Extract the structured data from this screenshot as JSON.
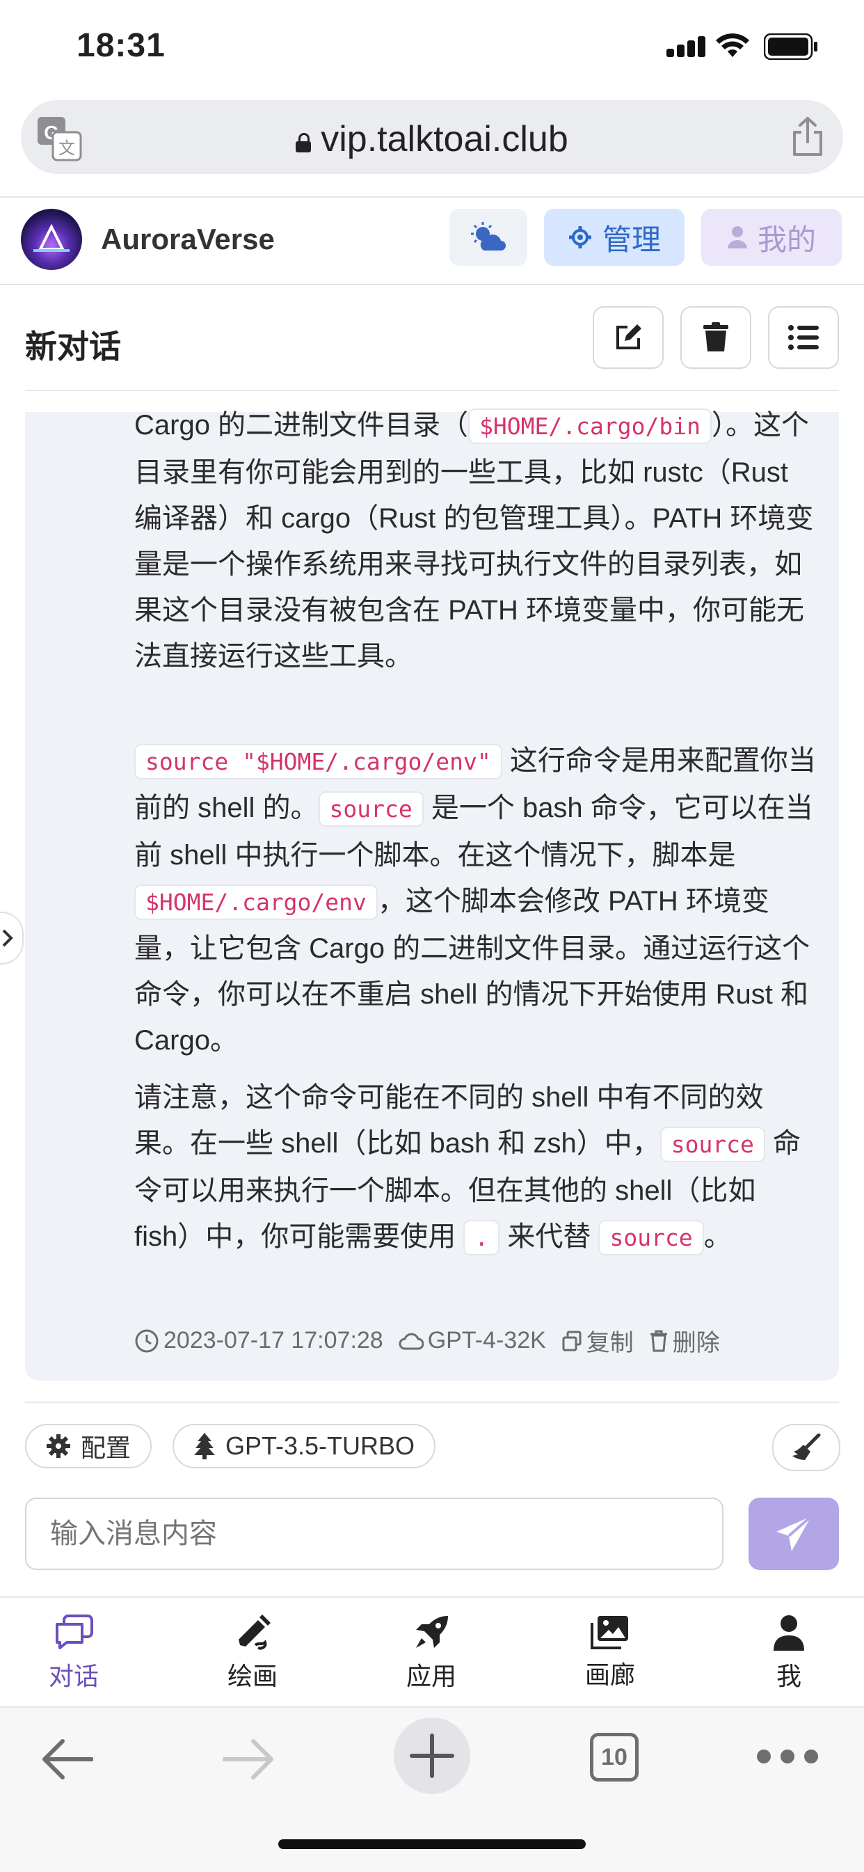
{
  "status": {
    "time": "18:31"
  },
  "browser": {
    "url": "vip.talktoai.club",
    "tabs_count": "10"
  },
  "header": {
    "brand": "AuroraVerse",
    "admin_label": "管理",
    "mine_label": "我的"
  },
  "page": {
    "title": "新对话"
  },
  "message": {
    "p1": [
      "Cargo 的二进制文件目录（",
      "$HOME/.cargo/bin",
      "）。这个目录里有你可能会用到的一些工具，比如 rustc（Rust 编译器）和 cargo（Rust 的包管理工具）。PATH 环境变量是一个操作系统用来寻找可执行文件的目录列表，如果这个目录没有被包含在 PATH 环境变量中，你可能无法直接运行这些工具。"
    ],
    "p2": [
      "source \"$HOME/.cargo/env\"",
      " 这行命令是用来配置你当前的 shell 的。",
      "source",
      " 是一个 bash 命令，它可以在当前 shell 中执行一个脚本。在这个情况下，脚本是 ",
      "$HOME/.cargo/env",
      "，这个脚本会修改 PATH 环境变量，让它包含 Cargo 的二进制文件目录。通过运行这个命令，你可以在不重启 shell 的情况下开始使用 Rust 和 Cargo。"
    ],
    "p3": [
      "请注意，这个命令可能在不同的 shell 中有不同的效果。在一些 shell（比如 bash 和 zsh）中，",
      "source",
      " 命令可以用来执行一个脚本。但在其他的 shell（比如 fish）中，你可能需要使用 ",
      ".",
      " 来代替 ",
      "source",
      "。"
    ],
    "timestamp": "2023-07-17 17:07:28",
    "model": "GPT-4-32K",
    "copy_label": "复制",
    "delete_label": "删除"
  },
  "controls": {
    "config_label": "配置",
    "model_label": "GPT-3.5-TURBO",
    "input_placeholder": "输入消息内容"
  },
  "nav": [
    {
      "label": "对话",
      "icon": "chat-icon",
      "active": true
    },
    {
      "label": "绘画",
      "icon": "paint-icon"
    },
    {
      "label": "应用",
      "icon": "rocket-icon"
    },
    {
      "label": "画廊",
      "icon": "gallery-icon"
    },
    {
      "label": "我",
      "icon": "user-icon"
    }
  ],
  "colors": {
    "accent": "#6b4fbb",
    "admin_bg": "#d6e6ff",
    "mine_bg": "#ece6fa",
    "send_bg": "#b3a6e6",
    "code_text": "#d6336c",
    "message_bg": "#eff2f7"
  }
}
